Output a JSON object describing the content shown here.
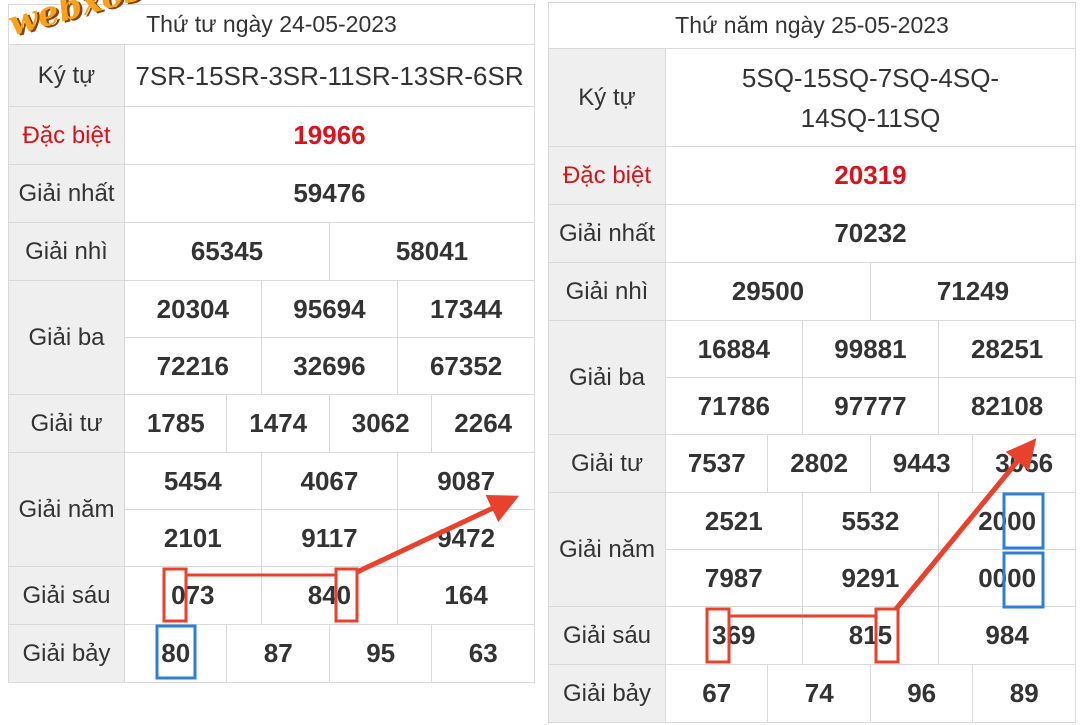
{
  "watermark": "webxoso.net",
  "labels": {
    "code": "Ký tự",
    "special": "Đặc biệt",
    "first": "Giải nhất",
    "second": "Giải nhì",
    "third": "Giải ba",
    "fourth": "Giải tư",
    "fifth": "Giải năm",
    "sixth": "Giải sáu",
    "seventh": "Giải bảy"
  },
  "left": {
    "header": "Thứ tư ngày 24-05-2023",
    "code": "7SR-15SR-3SR-11SR-13SR-6SR",
    "special": "19966",
    "first": "59476",
    "second": [
      "65345",
      "58041"
    ],
    "third": [
      "20304",
      "95694",
      "17344",
      "72216",
      "32696",
      "67352"
    ],
    "fourth": [
      "1785",
      "1474",
      "3062",
      "2264"
    ],
    "fifth": [
      "5454",
      "4067",
      "9087",
      "2101",
      "9117",
      "9472"
    ],
    "sixth": [
      "073",
      "840",
      "164"
    ],
    "seventh": [
      "80",
      "87",
      "95",
      "63"
    ]
  },
  "right": {
    "header": "Thứ năm ngày 25-05-2023",
    "code": "5SQ-15SQ-7SQ-4SQ-14SQ-11SQ",
    "special": "20319",
    "first": "70232",
    "second": [
      "29500",
      "71249"
    ],
    "third": [
      "16884",
      "99881",
      "28251",
      "71786",
      "97777",
      "82108"
    ],
    "fourth": [
      "7537",
      "2802",
      "9443",
      "3056"
    ],
    "fifth": [
      "2521",
      "5532",
      "2000",
      "7987",
      "9291",
      "0000"
    ],
    "sixth": [
      "369",
      "815",
      "984"
    ],
    "seventh": [
      "67",
      "74",
      "96",
      "89"
    ]
  },
  "colors": {
    "highlight_red": "#e8412c",
    "highlight_blue": "#2f7fd6",
    "special": "#d3161d"
  }
}
